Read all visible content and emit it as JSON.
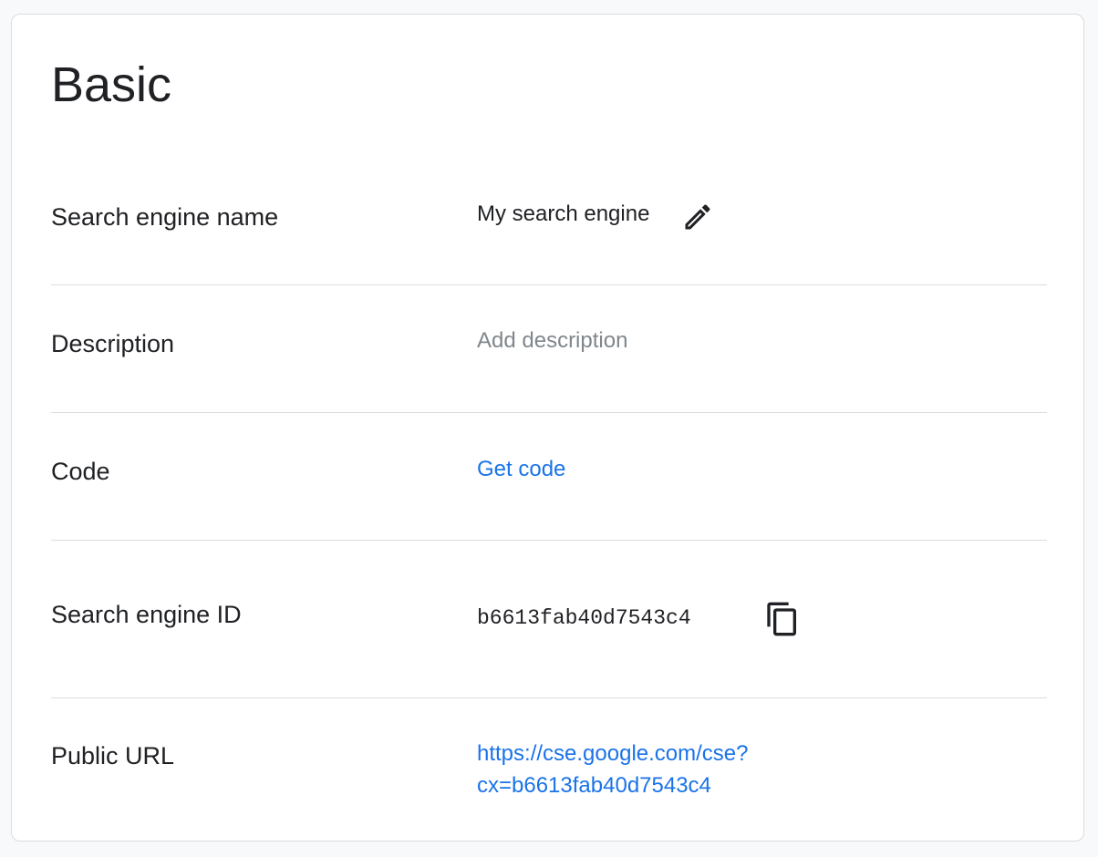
{
  "card": {
    "title": "Basic"
  },
  "rows": {
    "name": {
      "label": "Search engine name",
      "value": "My search engine",
      "edit_icon": "pencil-icon"
    },
    "description": {
      "label": "Description",
      "placeholder": "Add description"
    },
    "code": {
      "label": "Code",
      "link": "Get code"
    },
    "engine_id": {
      "label": "Search engine ID",
      "value": "b6613fab40d7543c4",
      "copy_icon": "copy-icon"
    },
    "public_url": {
      "label": "Public URL",
      "line1": "https://cse.google.com/cse?",
      "line2": "cx=b6613fab40d7543c4"
    }
  },
  "colors": {
    "link": "#1a73e8",
    "muted": "#80868b",
    "text": "#202124",
    "divider": "#dadce0"
  }
}
